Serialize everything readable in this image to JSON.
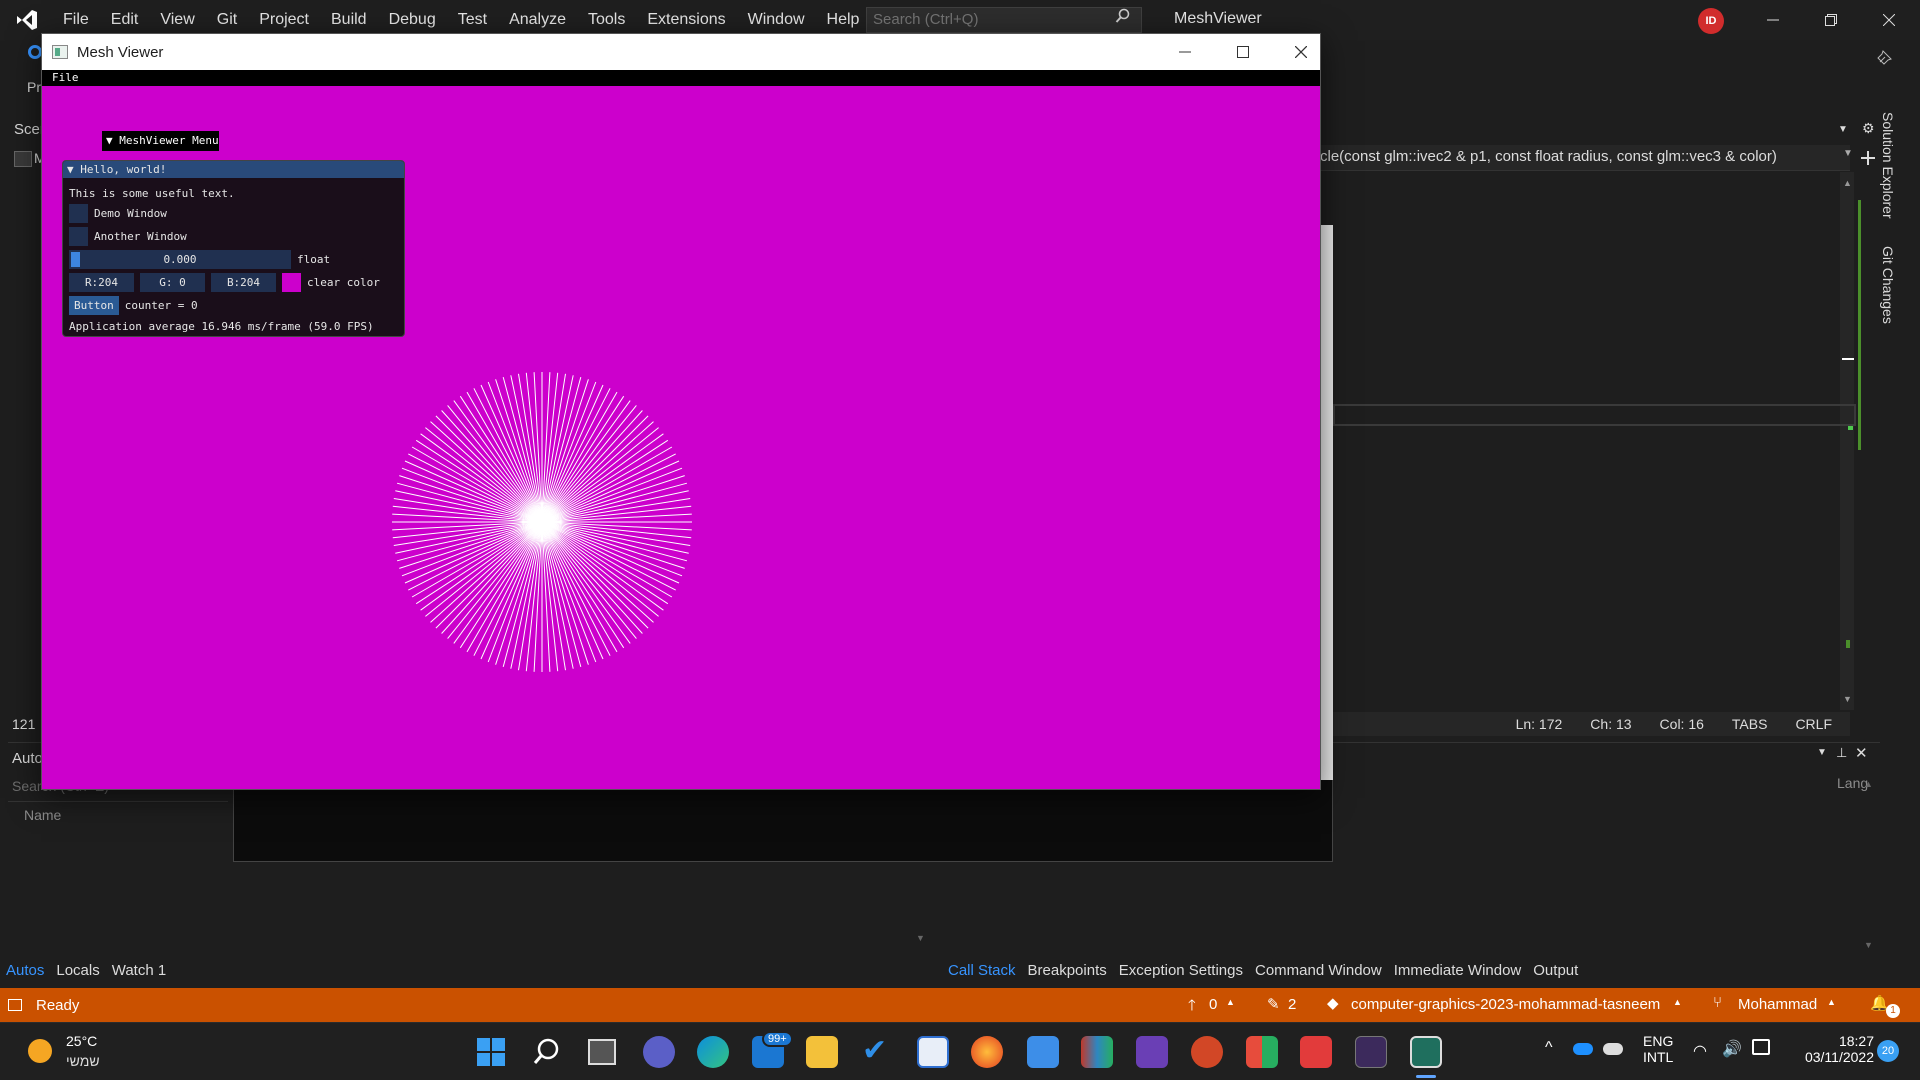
{
  "vs": {
    "menu": [
      "File",
      "Edit",
      "View",
      "Git",
      "Project",
      "Build",
      "Debug",
      "Test",
      "Analyze",
      "Tools",
      "Extensions",
      "Window",
      "Help"
    ],
    "search_placeholder": "Search (Ctrl+Q)",
    "solution_name": "MeshViewer",
    "avatar_initials": "ID",
    "left_frag_1": "Pr",
    "left_frag_2": "Scer",
    "left_frag_3": "M",
    "left_frag_4": "121",
    "func_signature": "cle(const glm::ivec2 & p1, const float radius, const glm::vec3 & color)",
    "right_tool_1": "Solution Explorer",
    "right_tool_2": "Git Changes",
    "status_line": {
      "ln": "Ln: 172",
      "ch": "Ch: 13",
      "col": "Col: 16",
      "tabs": "TABS",
      "crlf": "CRLF"
    },
    "autos": {
      "title": "Auto",
      "search": "Search (Ctrl+E)",
      "col_name": "Name",
      "tabs": [
        "Autos",
        "Locals",
        "Watch 1"
      ]
    },
    "callstack": {
      "col_lang": "Lang",
      "tabs": [
        "Call Stack",
        "Breakpoints",
        "Exception Settings",
        "Command Window",
        "Immediate Window",
        "Output"
      ]
    },
    "statusbar": {
      "ready": "Ready",
      "up_count": "0",
      "edit_count": "2",
      "repo": "computer-graphics-2023-mohammad-tasneem",
      "branch": "Mohammad",
      "notif": "1"
    }
  },
  "mesh_viewer": {
    "title": "Mesh Viewer",
    "menu_file": "File",
    "clear_color_hex": "#cc00cc",
    "menu_tab": "MeshViewer Menu",
    "imgui": {
      "title": "Hello, world!",
      "text": "This is some useful text.",
      "demo_window": "Demo Window",
      "another_window": "Another Window",
      "float_value": "0.000",
      "float_label": "float",
      "r": "R:204",
      "g": "G:  0",
      "b": "B:204",
      "clear_color_label": "clear color",
      "button": "Button",
      "counter": "counter = 0",
      "fps": "Application average 16.946 ms/frame (59.0 FPS)"
    },
    "starburst_lines": 120
  },
  "taskbar": {
    "weather_temp": "25°C",
    "weather_text": "שמשי",
    "mail_badge": "99+",
    "lang_1": "ENG",
    "lang_2": "INTL",
    "time": "18:27",
    "date": "03/11/2022",
    "notif_count": "20"
  },
  "colors": {
    "accent": "#3794ff",
    "statusbar": "#ca5100",
    "magenta": "#cc00cc"
  }
}
